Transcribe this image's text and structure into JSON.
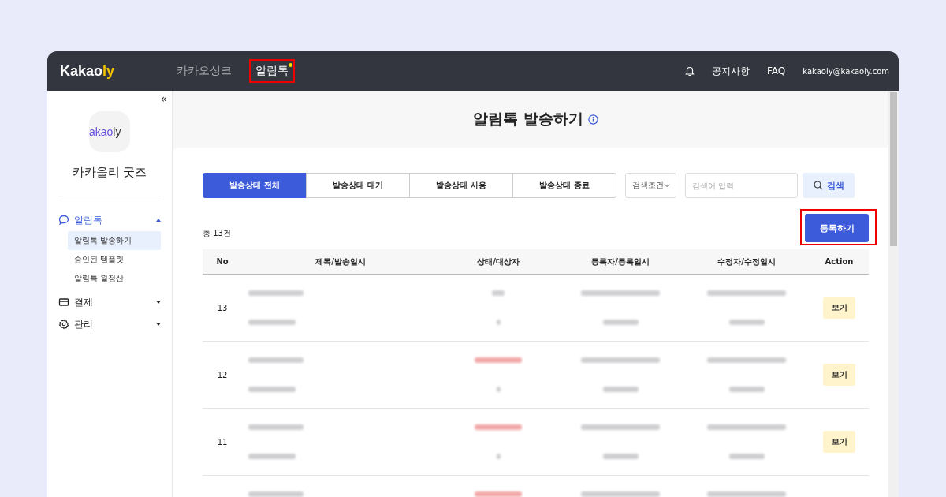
{
  "logo": {
    "main": "Kakao",
    "accent": "ly"
  },
  "nav": [
    {
      "label": "카카오싱크",
      "selected": false,
      "highlighted": false,
      "dot": false
    },
    {
      "label": "알림톡",
      "selected": true,
      "highlighted": true,
      "dot": true
    }
  ],
  "header_links": [
    {
      "kind": "bell"
    },
    {
      "kind": "text",
      "label": "공지사항"
    },
    {
      "kind": "text",
      "label": "FAQ"
    },
    {
      "kind": "email",
      "label": "kakaoly@kakaoly.com"
    }
  ],
  "sidebar": {
    "collapse": "«",
    "brand_logo": {
      "main": "akao",
      "accent": "ly"
    },
    "brand_name": "카카올리 굿즈",
    "items": [
      {
        "label": "알림톡",
        "kind": "chat",
        "selected": true,
        "expanded": true,
        "children": [
          {
            "label": "알림톡 발송하기",
            "selected": true
          },
          {
            "label": "승인된 템플릿",
            "selected": false
          },
          {
            "label": "알림톡 월정산",
            "selected": false
          }
        ]
      },
      {
        "label": "결제",
        "kind": "card",
        "selected": false,
        "expanded": false
      },
      {
        "label": "관리",
        "kind": "gear",
        "selected": false,
        "expanded": false
      }
    ]
  },
  "page_title": "알림톡 발송하기",
  "tabs": [
    {
      "label": "발송상태 전체",
      "selected": true
    },
    {
      "label": "발송상태 대기",
      "selected": false
    },
    {
      "label": "발송상태 사용",
      "selected": false
    },
    {
      "label": "발송상태 종료",
      "selected": false
    }
  ],
  "search": {
    "condition": "검색조건",
    "placeholder": "검색어 입력",
    "button": "검색"
  },
  "register_button": {
    "label": "등록하기",
    "highlighted": true
  },
  "total": "총 13건",
  "table": {
    "columns": [
      "No",
      "제목/발송일시",
      "상태/대상자",
      "등록자/등록일시",
      "수정자/수정일시",
      "Action"
    ],
    "rows": [
      {
        "no": "13",
        "status_alert": false,
        "action": "보기"
      },
      {
        "no": "12",
        "status_alert": true,
        "action": "보기"
      },
      {
        "no": "11",
        "status_alert": true,
        "action": "보기"
      },
      {
        "status_alert": true
      }
    ]
  }
}
